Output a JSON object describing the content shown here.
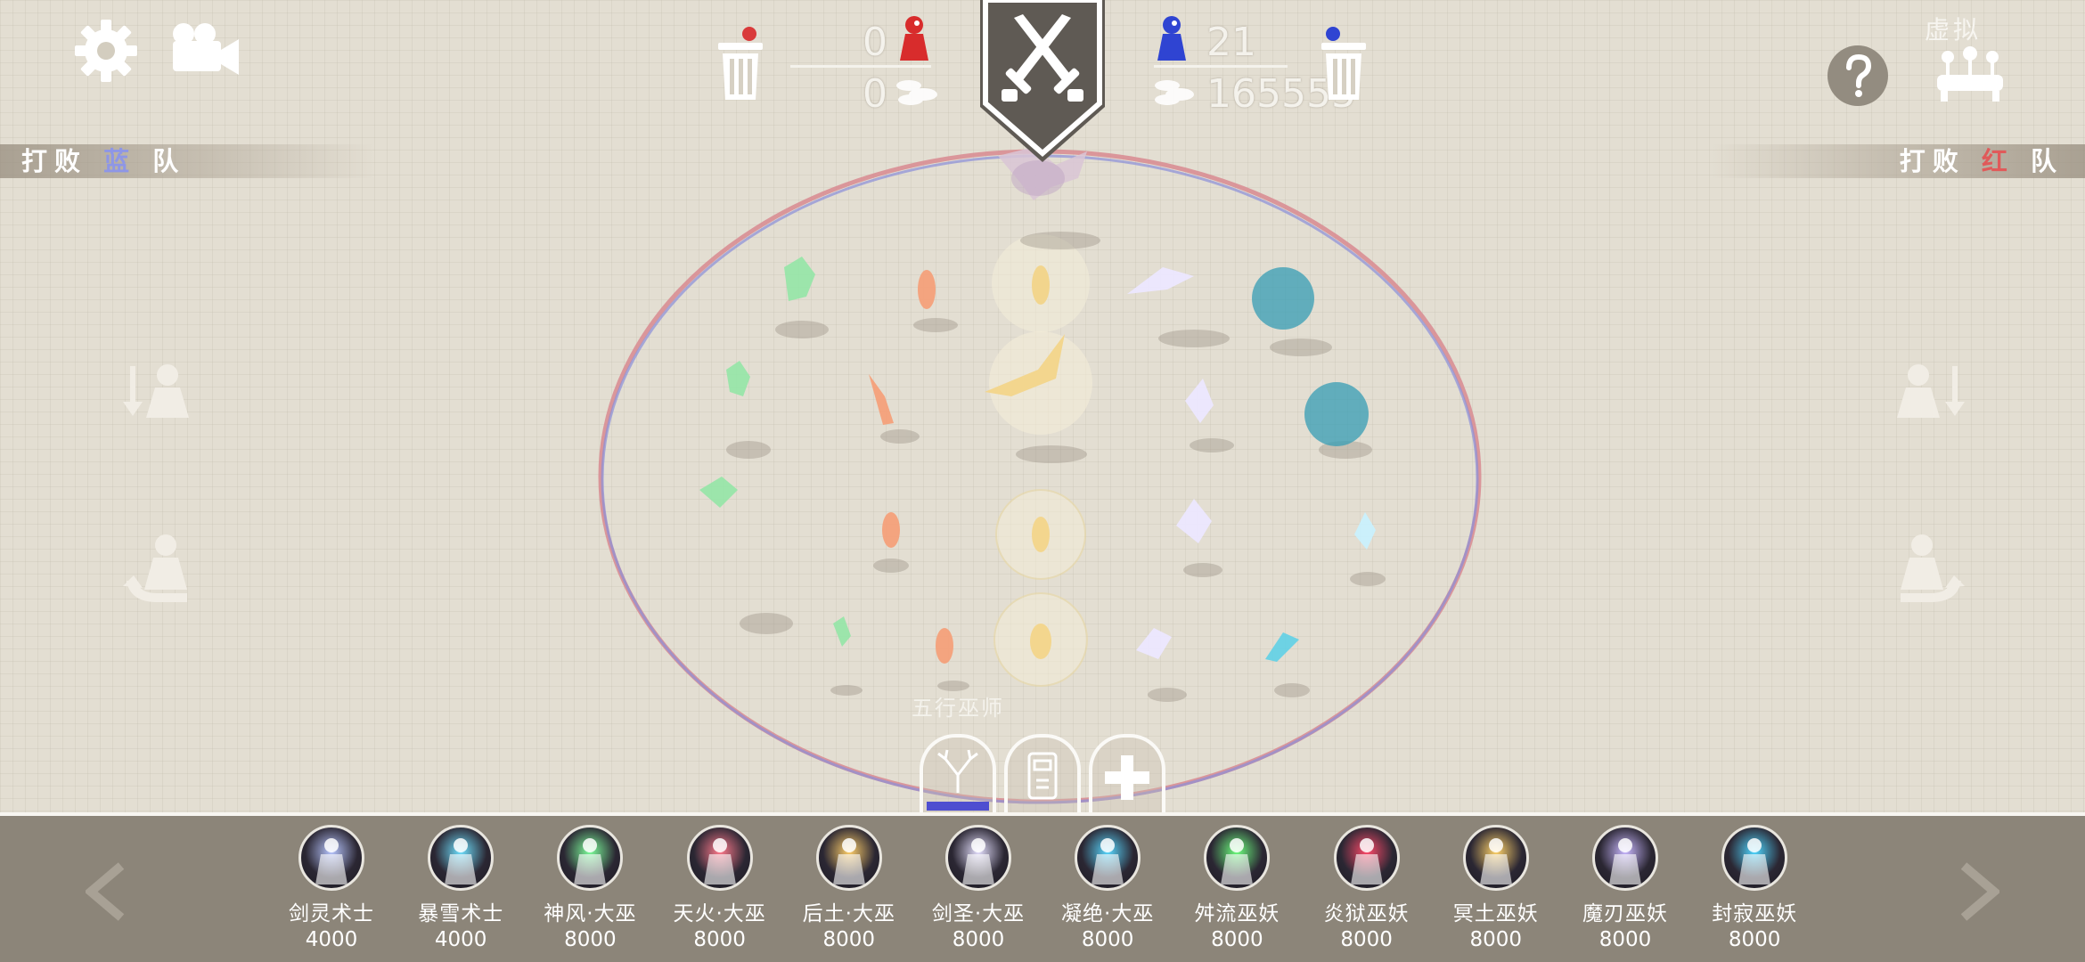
{
  "header": {
    "red_score": "0",
    "red_coins": "0",
    "blue_score": "21",
    "blue_coins": "165555",
    "virtual_label": "虚拟"
  },
  "banners": {
    "left": {
      "prefix": "打败",
      "team": "蓝",
      "suffix": "队"
    },
    "right": {
      "prefix": "打败",
      "team": "红",
      "suffix": "队"
    }
  },
  "selected_unit_label": "五行巫师",
  "colors": {
    "blue_team": "#8e96e6",
    "red_team": "#e05a5a",
    "bar_bg": "#8c8579",
    "arena_bg": "#e3ded2"
  },
  "icons": {
    "settings": "gear-icon",
    "camera": "video-camera-icon",
    "trash": "trash-icon",
    "battle": "crossed-swords-icon",
    "help": "help-icon",
    "virtual": "joystick-icon",
    "prev": "chevron-left-icon",
    "next": "chevron-right-icon"
  },
  "units": [
    {
      "name": "剑灵术士",
      "cost": "4000",
      "color": "#b8c6ff"
    },
    {
      "name": "暴雪术士",
      "cost": "4000",
      "color": "#6fe1ff"
    },
    {
      "name": "神风·大巫",
      "cost": "8000",
      "color": "#7dff9b"
    },
    {
      "name": "天火·大巫",
      "cost": "8000",
      "color": "#ff7a8c"
    },
    {
      "name": "后土·大巫",
      "cost": "8000",
      "color": "#ffcf6a"
    },
    {
      "name": "剑圣·大巫",
      "cost": "8000",
      "color": "#e6e1ff"
    },
    {
      "name": "凝绝·大巫",
      "cost": "8000",
      "color": "#58d8ff"
    },
    {
      "name": "舛流巫妖",
      "cost": "8000",
      "color": "#6dff7e"
    },
    {
      "name": "炎狱巫妖",
      "cost": "8000",
      "color": "#ff4a6a"
    },
    {
      "name": "冥土巫妖",
      "cost": "8000",
      "color": "#ffd36a"
    },
    {
      "name": "魔刃巫妖",
      "cost": "8000",
      "color": "#c9b8ff"
    },
    {
      "name": "封寂巫妖",
      "cost": "8000",
      "color": "#4ed6ff"
    }
  ]
}
